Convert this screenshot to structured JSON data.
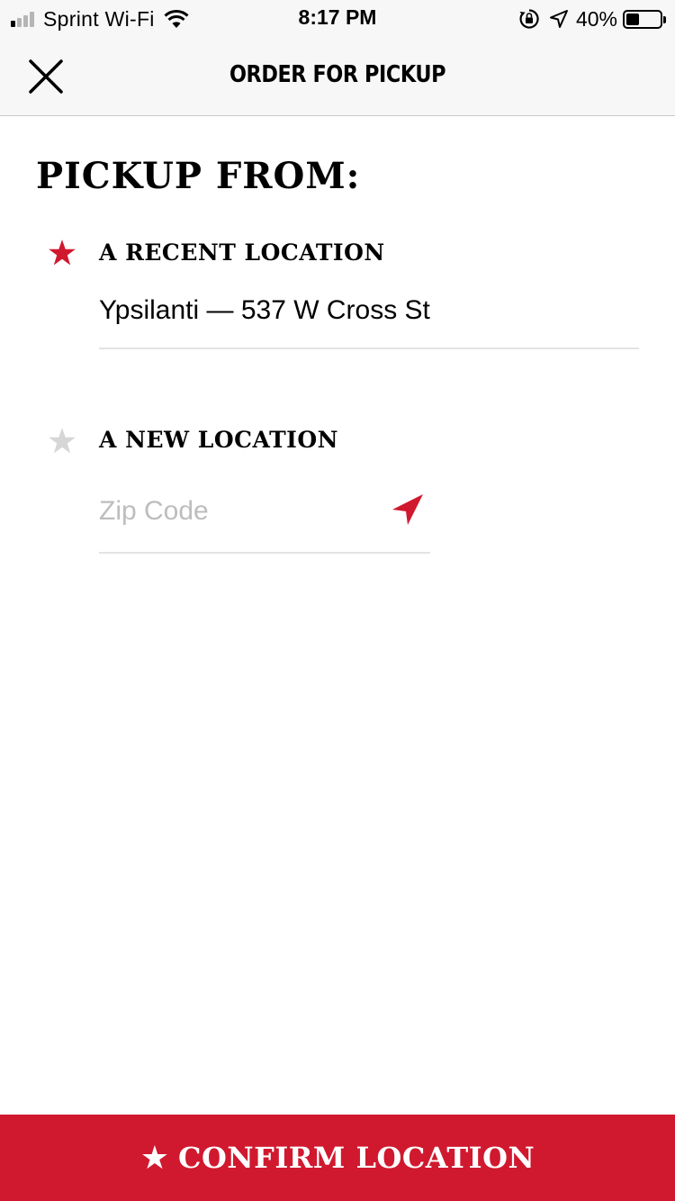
{
  "status_bar": {
    "carrier": "Sprint Wi-Fi",
    "time": "8:17 PM",
    "battery_percent": "40%",
    "battery_level": 0.4,
    "signal_bars_active": 1,
    "signal_bars_total": 4,
    "icons": [
      "signal-icon",
      "wifi-icon",
      "orientation-lock-icon",
      "location-arrow-icon",
      "battery-icon"
    ]
  },
  "nav": {
    "title": "ORDER FOR PICKUP",
    "close_icon": "close-icon"
  },
  "main": {
    "section_title": "PICKUP FROM:",
    "recent": {
      "label": "A RECENT LOCATION",
      "value": "Ypsilanti — 537 W Cross St",
      "selected": true
    },
    "new_location": {
      "label": "A NEW LOCATION",
      "zip_placeholder": "Zip Code",
      "zip_value": "",
      "selected": false,
      "locate_icon": "location-arrow-icon"
    }
  },
  "footer": {
    "confirm_label": "CONFIRM LOCATION"
  },
  "colors": {
    "accent": "#d0192f",
    "star_inactive": "#d6d6d6",
    "bar_background": "#f7f7f7",
    "placeholder": "#bdbdbd"
  }
}
